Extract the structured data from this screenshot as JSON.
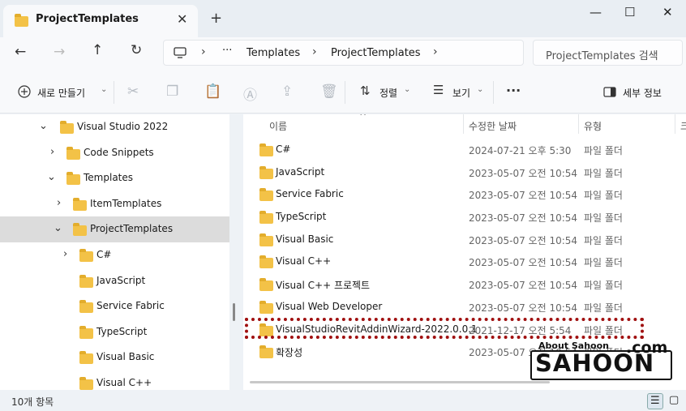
{
  "tab": {
    "title": "ProjectTemplates",
    "close": "✕",
    "add": "+"
  },
  "window": {
    "minimize": "—",
    "maximize": "☐",
    "close": "✕"
  },
  "nav": {
    "back": "←",
    "forward": "→",
    "up": "↑",
    "refresh": "↻"
  },
  "address": {
    "more": "···",
    "crumbs": [
      "Templates",
      "ProjectTemplates"
    ],
    "sep": "›"
  },
  "search": {
    "placeholder": "ProjectTemplates 검색"
  },
  "toolbar": {
    "new_label": "새로 만들기",
    "sort_label": "정렬",
    "view_label": "보기",
    "more": "···",
    "details_label": "세부 정보"
  },
  "tree": [
    {
      "label": "Visual Studio 2022",
      "chev": "⌄"
    },
    {
      "label": "Code Snippets",
      "chev": "›"
    },
    {
      "label": "Templates",
      "chev": "⌄"
    },
    {
      "label": "ItemTemplates",
      "chev": "›"
    },
    {
      "label": "ProjectTemplates",
      "chev": "⌄"
    },
    {
      "label": "C#",
      "chev": "›"
    },
    {
      "label": "JavaScript",
      "chev": ""
    },
    {
      "label": "Service Fabric",
      "chev": ""
    },
    {
      "label": "TypeScript",
      "chev": ""
    },
    {
      "label": "Visual Basic",
      "chev": ""
    },
    {
      "label": "Visual C++",
      "chev": ""
    }
  ],
  "columns": {
    "name": "이름",
    "date": "수정한 날짜",
    "type": "유형",
    "size": "크"
  },
  "files": [
    {
      "name": "C#",
      "date": "2024-07-21 오후 5:30",
      "type": "파일 폴더"
    },
    {
      "name": "JavaScript",
      "date": "2023-05-07 오전 10:54",
      "type": "파일 폴더"
    },
    {
      "name": "Service Fabric",
      "date": "2023-05-07 오전 10:54",
      "type": "파일 폴더"
    },
    {
      "name": "TypeScript",
      "date": "2023-05-07 오전 10:54",
      "type": "파일 폴더"
    },
    {
      "name": "Visual Basic",
      "date": "2023-05-07 오전 10:54",
      "type": "파일 폴더"
    },
    {
      "name": "Visual C++",
      "date": "2023-05-07 오전 10:54",
      "type": "파일 폴더"
    },
    {
      "name": "Visual C++ 프로젝트",
      "date": "2023-05-07 오전 10:54",
      "type": "파일 폴더"
    },
    {
      "name": "Visual Web Developer",
      "date": "2023-05-07 오전 10:54",
      "type": "파일 폴더"
    },
    {
      "name": "VisualStudioRevitAddinWizard-2022.0.0.1",
      "date": "2021-12-17 오전 5:54",
      "type": "파일 폴더"
    },
    {
      "name": "확장성",
      "date": "2023-05-07 오전 10:54",
      "type": "파일 폴더"
    }
  ],
  "status": {
    "count": "10개 항목"
  },
  "watermark": {
    "about": "About Sahoon",
    "brand": "SAHOON",
    "com": ".com"
  },
  "colors": {
    "folder": "#f3c247",
    "highlight": "#a01010",
    "selected": "#dcdcdc"
  }
}
